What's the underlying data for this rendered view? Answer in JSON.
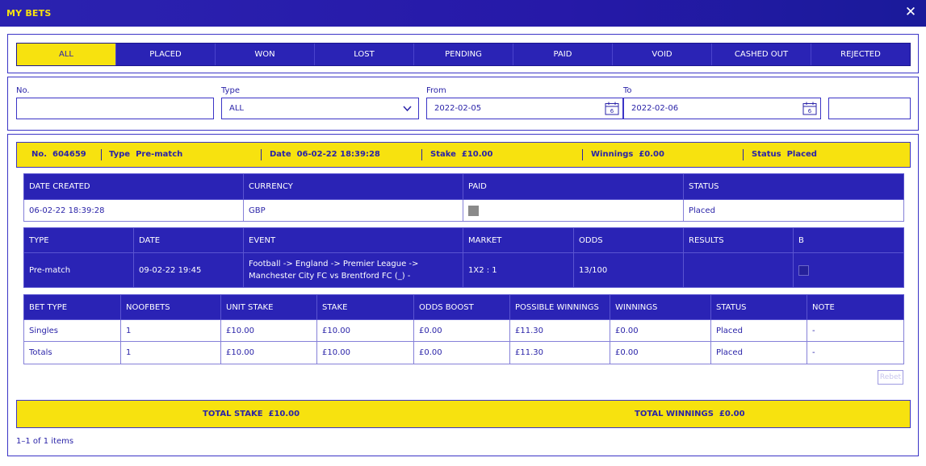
{
  "window": {
    "title": "MY BETS"
  },
  "tabs": [
    "ALL",
    "PLACED",
    "WON",
    "LOST",
    "PENDING",
    "PAID",
    "VOID",
    "CASHED OUT",
    "REJECTED"
  ],
  "filters": {
    "no_label": "No.",
    "no_value": "",
    "type_label": "Type",
    "type_value": "ALL",
    "from_label": "From",
    "from_value": "2022-02-05",
    "to_label": "To",
    "to_value": "2022-02-06",
    "calendar_day": "6",
    "extra_value": ""
  },
  "bet": {
    "no_label": "No.",
    "no_value": "604659",
    "type_label": "Type",
    "type_value": "Pre-match",
    "date_label": "Date",
    "date_value": "06-02-22 18:39:28",
    "stake_label": "Stake",
    "stake_value": "£10.00",
    "winnings_label": "Winnings",
    "winnings_value": "£0.00",
    "status_label": "Status",
    "status_value": "Placed"
  },
  "info_table": {
    "headers": [
      "DATE CREATED",
      "CURRENCY",
      "PAID",
      "STATUS"
    ],
    "row": {
      "date_created": "06-02-22 18:39:28",
      "currency": "GBP",
      "status": "Placed"
    }
  },
  "selection_table": {
    "headers": [
      "TYPE",
      "DATE",
      "EVENT",
      "MARKET",
      "ODDS",
      "RESULTS",
      "B"
    ],
    "row": {
      "type": "Pre-match",
      "date": "09-02-22 19:45",
      "event": "Football -> England -> Premier League -> Manchester City FC vs Brentford FC (_) -",
      "market": "1X2 : 1",
      "odds": "13/100",
      "results": ""
    }
  },
  "bets_table": {
    "headers": [
      "BET TYPE",
      "NOOFBETS",
      "UNIT STAKE",
      "STAKE",
      "ODDS BOOST",
      "POSSIBLE WINNINGS",
      "WINNINGS",
      "STATUS",
      "NOTE"
    ],
    "rows": [
      [
        "Singles",
        "1",
        "£10.00",
        "£10.00",
        "£0.00",
        "£11.30",
        "£0.00",
        "Placed",
        "-"
      ],
      [
        "Totals",
        "1",
        "£10.00",
        "£10.00",
        "£0.00",
        "£11.30",
        "£0.00",
        "Placed",
        "-"
      ]
    ]
  },
  "rebet_label": "Rebet",
  "totals": {
    "stake_label": "TOTAL STAKE",
    "stake_value": "£10.00",
    "winnings_label": "TOTAL WINNINGS",
    "winnings_value": "£0.00"
  },
  "pager": {
    "text": "1–1 of 1 items"
  },
  "colors": {
    "primary": "#2a23b5",
    "accent": "#f7e20f",
    "text": "#2a23a8"
  },
  "icons": {
    "close": "close-icon",
    "calendar": "calendar-icon",
    "chevron": "chevron-down-icon"
  }
}
